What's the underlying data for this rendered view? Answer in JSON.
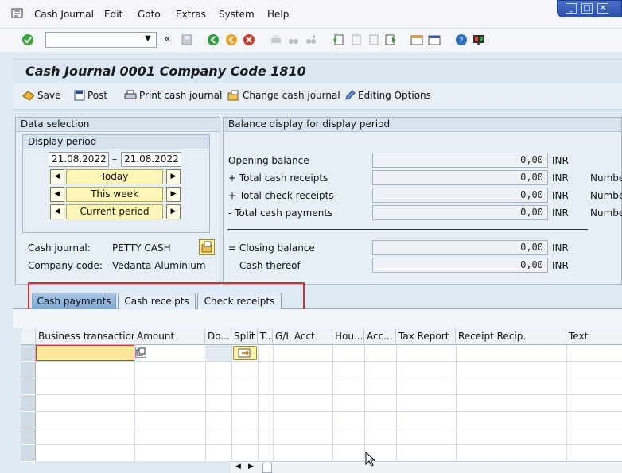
{
  "menu": [
    "Cash Journal",
    "Edit",
    "Goto",
    "Extras",
    "System",
    "Help"
  ],
  "window_controls": [
    "minimize",
    "restore",
    "close"
  ],
  "toolbar": {
    "command_field_value": "",
    "back_label": "«"
  },
  "title": "Cash Journal 0001 Company Code 1810",
  "app_toolbar": [
    {
      "label": "Save",
      "icon": "save-icon"
    },
    {
      "label": "Post",
      "icon": "post-icon"
    },
    {
      "label": "Print cash journal",
      "icon": "print-icon"
    },
    {
      "label": "Change cash journal",
      "icon": "change-icon"
    },
    {
      "label": "Editing Options",
      "icon": "pencil-icon"
    }
  ],
  "data_selection": {
    "title": "Data selection",
    "display_period": {
      "title": "Display period",
      "from": "21.08.2022",
      "separator": "–",
      "to": "21.08.2022",
      "buttons": [
        "Today",
        "This week",
        "Current period"
      ]
    },
    "cash_journal_label": "Cash journal:",
    "cash_journal_value": "PETTY CASH",
    "company_code_label": "Company code:",
    "company_code_value": "Vedanta Aluminium"
  },
  "balance": {
    "title": "Balance display for display period",
    "currency": "INR",
    "rows": [
      {
        "label": "Opening balance",
        "value": "0,00",
        "extra": ""
      },
      {
        "label": "+ Total cash receipts",
        "value": "0,00",
        "extra": "Numbe"
      },
      {
        "label": "+ Total check receipts",
        "value": "0,00",
        "extra": "Numbe"
      },
      {
        "label": "- Total cash payments",
        "value": "0,00",
        "extra": "Numbe"
      },
      {
        "label": "= Closing balance",
        "value": "0,00",
        "extra": ""
      },
      {
        "label": "Cash thereof",
        "value": "0,00",
        "extra": ""
      }
    ]
  },
  "tabs": [
    {
      "label": "Cash payments",
      "active": true
    },
    {
      "label": "Cash receipts",
      "active": false
    },
    {
      "label": "Check receipts",
      "active": false
    }
  ],
  "grid": {
    "columns": [
      "Business transaction",
      "Amount",
      "Do...",
      "Split",
      "T...",
      "G/L Acct",
      "Hou...",
      "Acc...",
      "Tax Report",
      "Receipt Recip.",
      "Text"
    ]
  },
  "colors": {
    "accent": "#7da7d6",
    "highlight": "#d23131",
    "input_active": "#ffe89a"
  }
}
